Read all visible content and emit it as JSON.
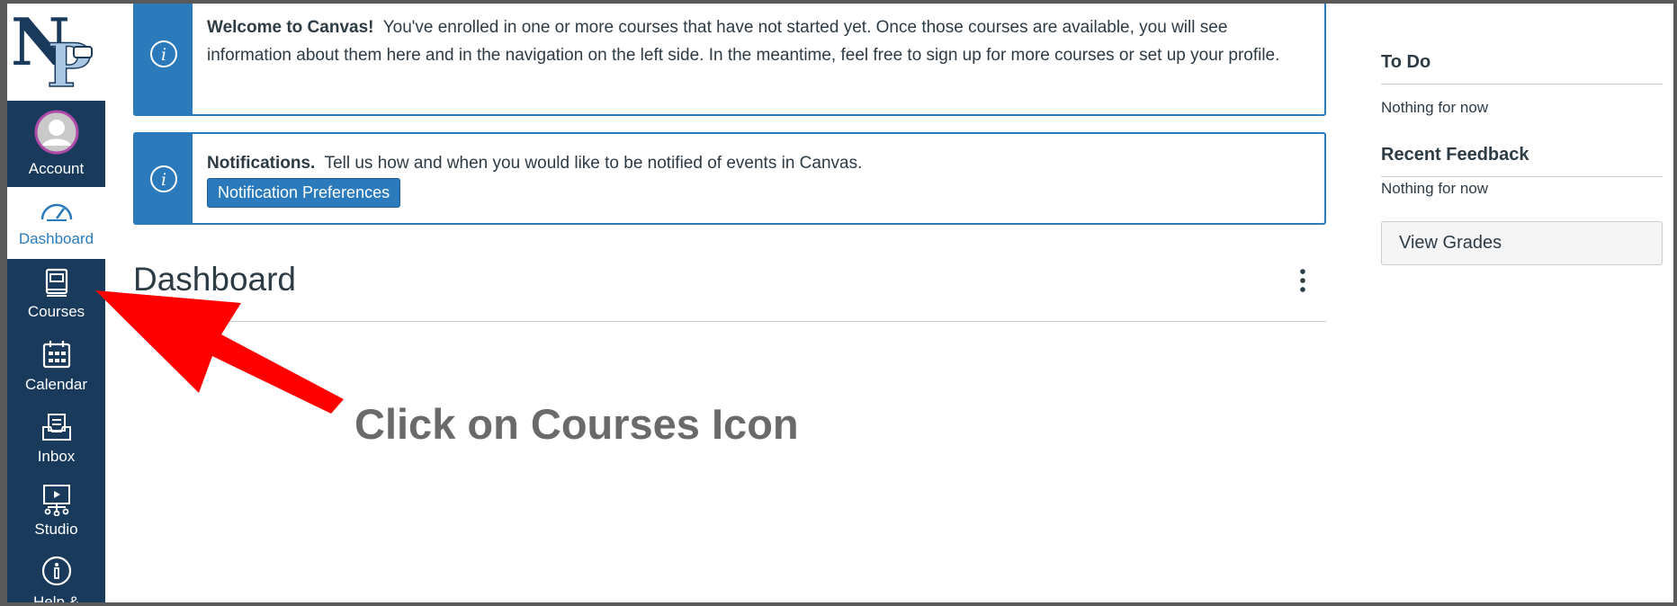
{
  "sidebar": {
    "logo_text": "NP",
    "items": [
      {
        "label": "Account",
        "icon": "avatar-icon"
      },
      {
        "label": "Dashboard",
        "icon": "speedometer-icon"
      },
      {
        "label": "Courses",
        "icon": "book-icon"
      },
      {
        "label": "Calendar",
        "icon": "calendar-icon"
      },
      {
        "label": "Inbox",
        "icon": "inbox-icon"
      },
      {
        "label": "Studio",
        "icon": "studio-icon"
      },
      {
        "label": "Help &",
        "icon": "help-icon"
      }
    ]
  },
  "welcome": {
    "title": "Welcome to Canvas!",
    "body": "You've enrolled in one or more courses that have not started yet. Once those courses are available, you will see information about them here and in the navigation on the left side. In the meantime, feel free to sign up for more courses or set up your profile."
  },
  "notifications": {
    "title": "Notifications.",
    "body": "Tell us how and when you would like to be notified of events in Canvas.",
    "button": "Notification Preferences"
  },
  "dashboard": {
    "title": "Dashboard"
  },
  "overlay": {
    "instruction": "Click on Courses Icon"
  },
  "right_sidebar": {
    "todo_heading": "To Do",
    "todo_empty": "Nothing for now",
    "feedback_heading": "Recent Feedback",
    "feedback_empty": "Nothing for now",
    "grades_button": "View Grades"
  },
  "colors": {
    "nav_bg": "#1a3a5c",
    "accent": "#2b7abc",
    "arrow": "#ff0000"
  }
}
